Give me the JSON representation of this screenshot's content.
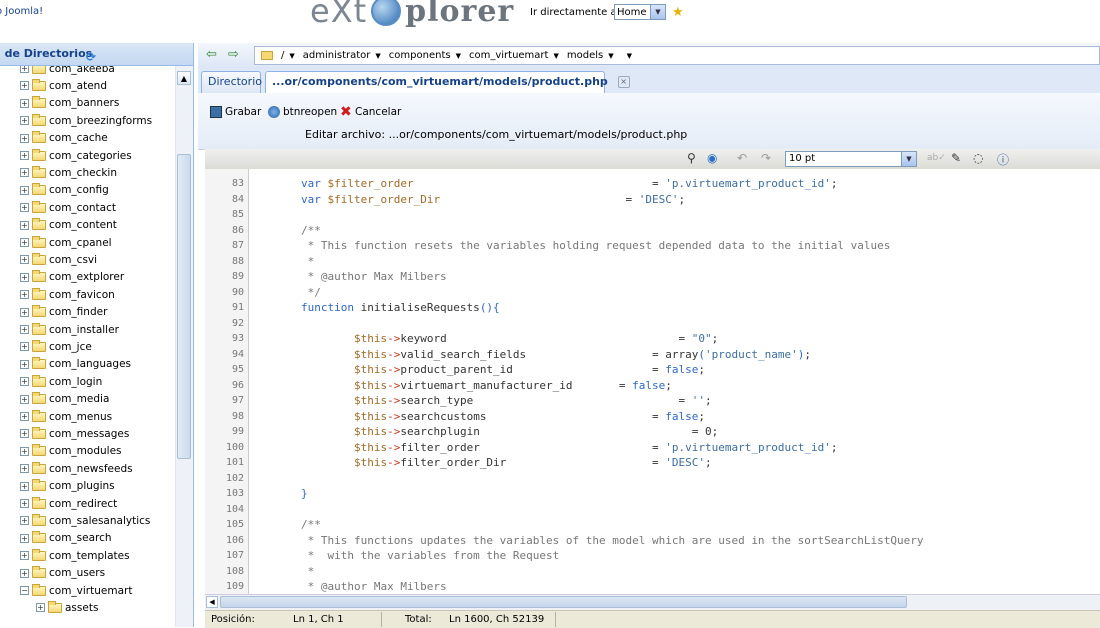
{
  "header": {
    "back_link": "o Joomla!",
    "logo_left": "eXt",
    "logo_right": "plorer",
    "jump_label": "Ir directamente a:",
    "jump_value": "Home"
  },
  "left_panel": {
    "title": "l de Directorios",
    "tree": [
      {
        "label": "com_akeeba",
        "exp": "+"
      },
      {
        "label": "com_atend",
        "exp": "+"
      },
      {
        "label": "com_banners",
        "exp": "+"
      },
      {
        "label": "com_breezingforms",
        "exp": "+"
      },
      {
        "label": "com_cache",
        "exp": "+"
      },
      {
        "label": "com_categories",
        "exp": "+"
      },
      {
        "label": "com_checkin",
        "exp": "+"
      },
      {
        "label": "com_config",
        "exp": "+"
      },
      {
        "label": "com_contact",
        "exp": "+"
      },
      {
        "label": "com_content",
        "exp": "+"
      },
      {
        "label": "com_cpanel",
        "exp": "+"
      },
      {
        "label": "com_csvi",
        "exp": "+"
      },
      {
        "label": "com_extplorer",
        "exp": "+"
      },
      {
        "label": "com_favicon",
        "exp": "+"
      },
      {
        "label": "com_finder",
        "exp": "+"
      },
      {
        "label": "com_installer",
        "exp": "+"
      },
      {
        "label": "com_jce",
        "exp": "+"
      },
      {
        "label": "com_languages",
        "exp": "+"
      },
      {
        "label": "com_login",
        "exp": "+"
      },
      {
        "label": "com_media",
        "exp": "+"
      },
      {
        "label": "com_menus",
        "exp": "+"
      },
      {
        "label": "com_messages",
        "exp": "+"
      },
      {
        "label": "com_modules",
        "exp": "+"
      },
      {
        "label": "com_newsfeeds",
        "exp": "+"
      },
      {
        "label": "com_plugins",
        "exp": "+"
      },
      {
        "label": "com_redirect",
        "exp": "+"
      },
      {
        "label": "com_salesanalytics",
        "exp": "+"
      },
      {
        "label": "com_search",
        "exp": "+"
      },
      {
        "label": "com_templates",
        "exp": "+"
      },
      {
        "label": "com_users",
        "exp": "+"
      },
      {
        "label": "com_virtuemart",
        "exp": "−"
      },
      {
        "label": "assets",
        "exp": "+",
        "sub": true
      }
    ]
  },
  "nav": {
    "path": [
      "/",
      "administrator",
      "components",
      "com_virtuemart",
      "models",
      ""
    ]
  },
  "tabs": {
    "directory": "Directorio",
    "file": "...or/components/com_virtuemart/models/product.php"
  },
  "toolbar": {
    "save": "Grabar",
    "reopen": "btnreopen",
    "cancel": "Cancelar",
    "edit_label": "Editar archivo: ...or/components/com_virtuemart/models/product.php"
  },
  "editor": {
    "font_size": "10 pt"
  },
  "code_lines": [
    {
      "n": "83",
      "segs": [
        [
          "",
          "        "
        ],
        [
          "kw",
          "var"
        ],
        [
          "",
          " "
        ],
        [
          "var",
          "$filter_order"
        ],
        [
          "",
          "                                    = "
        ],
        [
          "str",
          "'p.virtuemart_product_id'"
        ],
        [
          "",
          ";"
        ]
      ]
    },
    {
      "n": "84",
      "segs": [
        [
          "",
          "        "
        ],
        [
          "kw",
          "var"
        ],
        [
          "",
          " "
        ],
        [
          "var",
          "$filter_order_Dir"
        ],
        [
          "",
          "                            = "
        ],
        [
          "str",
          "'DESC'"
        ],
        [
          "",
          ";"
        ]
      ]
    },
    {
      "n": "85",
      "segs": [
        [
          "",
          ""
        ]
      ]
    },
    {
      "n": "86",
      "segs": [
        [
          "cm",
          "        /**"
        ]
      ]
    },
    {
      "n": "87",
      "segs": [
        [
          "cm",
          "         * This function resets the variables holding request depended data to the initial values"
        ]
      ]
    },
    {
      "n": "88",
      "segs": [
        [
          "cm",
          "         *"
        ]
      ]
    },
    {
      "n": "89",
      "segs": [
        [
          "cm",
          "         * @author Max Milbers"
        ]
      ]
    },
    {
      "n": "90",
      "segs": [
        [
          "cm",
          "         */"
        ]
      ]
    },
    {
      "n": "91",
      "segs": [
        [
          "",
          "        "
        ],
        [
          "kw",
          "function"
        ],
        [
          "",
          " initialiseRequests"
        ],
        [
          "kw",
          "(){"
        ]
      ]
    },
    {
      "n": "92",
      "segs": [
        [
          "",
          ""
        ]
      ]
    },
    {
      "n": "93",
      "segs": [
        [
          "",
          "                "
        ],
        [
          "var",
          "$this"
        ],
        [
          "arrow",
          "->"
        ],
        [
          "",
          "keyword"
        ],
        [
          "",
          "                                   = "
        ],
        [
          "str",
          "\"0\""
        ],
        [
          "",
          ";"
        ]
      ]
    },
    {
      "n": "94",
      "segs": [
        [
          "",
          "                "
        ],
        [
          "var",
          "$this"
        ],
        [
          "arrow",
          "->"
        ],
        [
          "",
          "valid_search_fields"
        ],
        [
          "",
          "                   = "
        ],
        [
          "",
          "array"
        ],
        [
          "kw",
          "("
        ],
        [
          "str",
          "'product_name'"
        ],
        [
          "kw",
          ")"
        ],
        [
          "",
          ";"
        ]
      ]
    },
    {
      "n": "95",
      "segs": [
        [
          "",
          "                "
        ],
        [
          "var",
          "$this"
        ],
        [
          "arrow",
          "->"
        ],
        [
          "",
          "product_parent_id"
        ],
        [
          "",
          "                     = "
        ],
        [
          "kw",
          "false"
        ],
        [
          "",
          ";"
        ]
      ]
    },
    {
      "n": "96",
      "segs": [
        [
          "",
          "                "
        ],
        [
          "var",
          "$this"
        ],
        [
          "arrow",
          "->"
        ],
        [
          "",
          "virtuemart_manufacturer_id"
        ],
        [
          "",
          "       = "
        ],
        [
          "kw",
          "false"
        ],
        [
          "",
          ";"
        ]
      ]
    },
    {
      "n": "97",
      "segs": [
        [
          "",
          "                "
        ],
        [
          "var",
          "$this"
        ],
        [
          "arrow",
          "->"
        ],
        [
          "",
          "search_type"
        ],
        [
          "",
          "                               = "
        ],
        [
          "str",
          "''"
        ],
        [
          "",
          ";"
        ]
      ]
    },
    {
      "n": "98",
      "segs": [
        [
          "",
          "                "
        ],
        [
          "var",
          "$this"
        ],
        [
          "arrow",
          "->"
        ],
        [
          "",
          "searchcustoms"
        ],
        [
          "",
          "                         = "
        ],
        [
          "kw",
          "false"
        ],
        [
          "",
          ";"
        ]
      ]
    },
    {
      "n": "99",
      "segs": [
        [
          "",
          "                "
        ],
        [
          "var",
          "$this"
        ],
        [
          "arrow",
          "->"
        ],
        [
          "",
          "searchplugin"
        ],
        [
          "",
          "                                = "
        ],
        [
          "",
          "0"
        ],
        [
          "",
          ";"
        ]
      ]
    },
    {
      "n": "100",
      "segs": [
        [
          "",
          "                "
        ],
        [
          "var",
          "$this"
        ],
        [
          "arrow",
          "->"
        ],
        [
          "",
          "filter_order"
        ],
        [
          "",
          "                          = "
        ],
        [
          "str",
          "'p.virtuemart_product_id'"
        ],
        [
          "",
          ";"
        ]
      ]
    },
    {
      "n": "101",
      "segs": [
        [
          "",
          "                "
        ],
        [
          "var",
          "$this"
        ],
        [
          "arrow",
          "->"
        ],
        [
          "",
          "filter_order_Dir"
        ],
        [
          "",
          "                      = "
        ],
        [
          "str",
          "'DESC'"
        ],
        [
          "",
          ";"
        ]
      ]
    },
    {
      "n": "102",
      "segs": [
        [
          "",
          ""
        ]
      ]
    },
    {
      "n": "103",
      "segs": [
        [
          "",
          "        "
        ],
        [
          "kw",
          "}"
        ]
      ]
    },
    {
      "n": "104",
      "segs": [
        [
          "",
          ""
        ]
      ]
    },
    {
      "n": "105",
      "segs": [
        [
          "cm",
          "        /**"
        ]
      ]
    },
    {
      "n": "106",
      "segs": [
        [
          "cm",
          "         * This functions updates the variables of the model which are used in the sortSearchListQuery"
        ]
      ]
    },
    {
      "n": "107",
      "segs": [
        [
          "cm",
          "         *  with the variables from the Request"
        ]
      ]
    },
    {
      "n": "108",
      "segs": [
        [
          "cm",
          "         *"
        ]
      ]
    },
    {
      "n": "109",
      "segs": [
        [
          "cm",
          "         * @author Max Milbers"
        ]
      ]
    }
  ],
  "status": {
    "pos_label": "Posición:",
    "pos_value": "Ln 1, Ch 1",
    "total_label": "Total:",
    "total_value": "Ln 1600, Ch 52139"
  }
}
